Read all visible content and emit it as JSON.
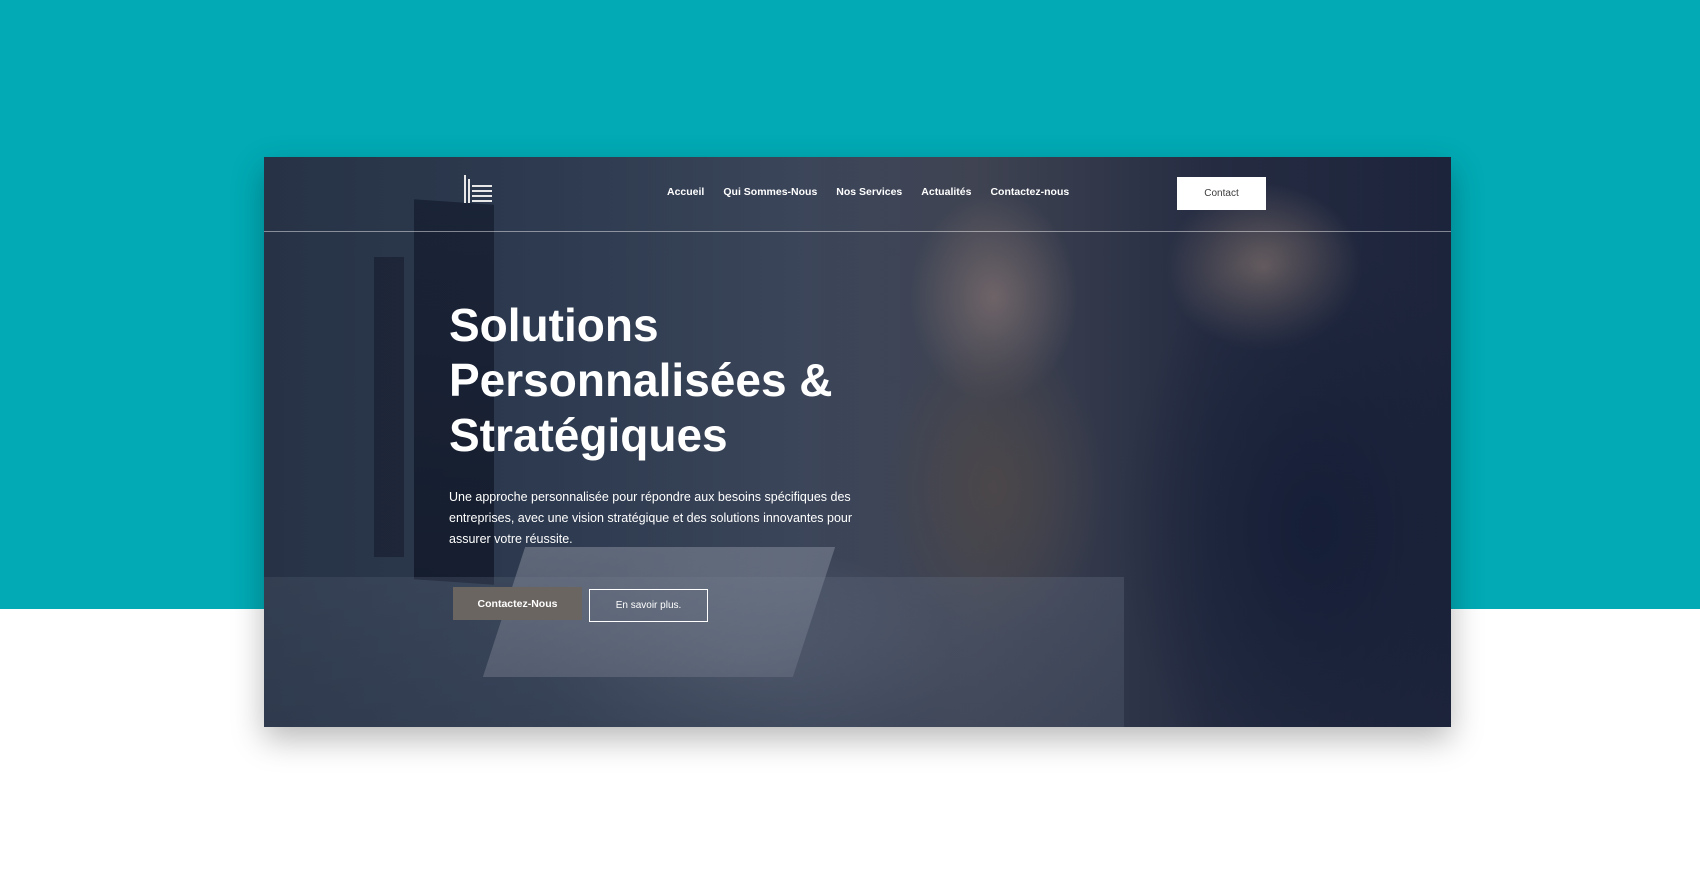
{
  "nav": {
    "items": [
      {
        "label": "Accueil"
      },
      {
        "label": "Qui Sommes-Nous"
      },
      {
        "label": "Nos Services"
      },
      {
        "label": "Actualités"
      },
      {
        "label": "Contactez-nous"
      }
    ],
    "contact_label": "Contact"
  },
  "hero": {
    "title_lines": [
      "Solutions",
      "Personnalisées &",
      "Stratégiques"
    ],
    "description": "Une approche personnalisée pour répondre aux besoins spécifiques des entreprises, avec une vision stratégique et des solutions innovantes pour assurer votre réussite.",
    "primary_button": "Contactez-Nous",
    "secondary_button": "En savoir plus."
  },
  "colors": {
    "backdrop": "#01aab5",
    "primary_button": "#6b6561",
    "text": "#ffffff"
  },
  "icons": {
    "logo": "building-logo-icon"
  }
}
